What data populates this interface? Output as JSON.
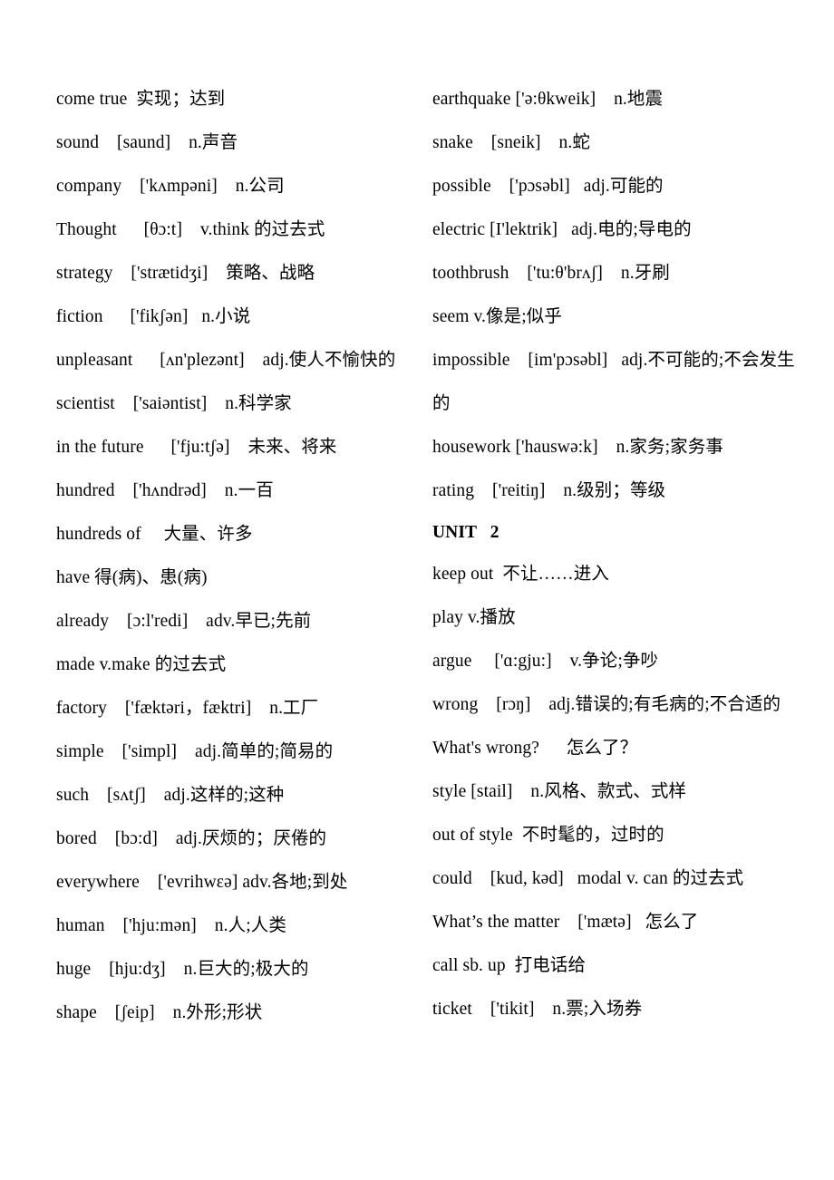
{
  "document": {
    "type": "vocabulary-word-list",
    "language_pair": "English-Chinese",
    "background_color": "#ffffff",
    "text_color": "#000000"
  },
  "left_column": {
    "entries": [
      {
        "id": "come-true",
        "text": "come true  实现；达到"
      },
      {
        "id": "sound",
        "text": "sound    [saund]    n.声音"
      },
      {
        "id": "company",
        "text": "company    ['kʌmpəni]    n.公司"
      },
      {
        "id": "thought",
        "text": "Thought      [θɔ:t]    v.think 的过去式"
      },
      {
        "id": "strategy",
        "text": "strategy    ['strætidʒi]    策略、战略"
      },
      {
        "id": "fiction",
        "text": "fiction      ['fikʃən]   n.小说"
      },
      {
        "id": "unpleasant",
        "text": "unpleasant      [ʌn'plezənt]    adj.使人不愉快的"
      },
      {
        "id": "scientist",
        "text": "scientist    ['saiəntist]    n.科学家"
      },
      {
        "id": "in-the-future",
        "text": "in the future      ['fju:tʃə]    未来、将来"
      },
      {
        "id": "hundred",
        "text": "hundred    ['hʌndrəd]    n.一百"
      },
      {
        "id": "hundreds-of",
        "text": "hundreds of     大量、许多"
      },
      {
        "id": "have",
        "text": "have 得(病)、患(病)"
      },
      {
        "id": "already",
        "text": "already    [ɔ:l'redi]    adv.早已;先前"
      },
      {
        "id": "made",
        "text": "made v.make 的过去式"
      },
      {
        "id": "factory",
        "text": "factory    ['fæktəri，fæktri]    n.工厂"
      },
      {
        "id": "simple",
        "text": "simple    ['simpl]    adj.简单的;简易的"
      },
      {
        "id": "such",
        "text": "such    [sʌtʃ]    adj.这样的;这种"
      },
      {
        "id": "bored",
        "text": "bored    [bɔ:d]    adj.厌烦的；厌倦的"
      },
      {
        "id": "everywhere",
        "text": "everywhere    ['evrihwɛə] adv.各地;到处"
      },
      {
        "id": "human",
        "text": "human    ['hju:mən]    n.人;人类"
      },
      {
        "id": "huge",
        "text": "huge    [hju:dʒ]    n.巨大的;极大的"
      },
      {
        "id": "shape",
        "text": "shape    [ʃeip]    n.外形;形状"
      }
    ]
  },
  "right_column": {
    "entries": [
      {
        "id": "earthquake",
        "text": "earthquake ['ə:θkweik]    n.地震",
        "bold": false
      },
      {
        "id": "snake",
        "text": "snake    [sneik]    n.蛇",
        "bold": false
      },
      {
        "id": "possible",
        "text": "possible    ['pɔsəbl]   adj.可能的",
        "bold": false
      },
      {
        "id": "electric",
        "text": "electric [I'lektrik]   adj.电的;导电的",
        "bold": false
      },
      {
        "id": "toothbrush",
        "text": "toothbrush    ['tu:θ'brʌʃ]    n.牙刷",
        "bold": false
      },
      {
        "id": "seem",
        "text": "seem v.像是;似乎",
        "bold": false
      },
      {
        "id": "impossible",
        "text": "impossible    [im'pɔsəbl]   adj.不可能的;不会发生的",
        "bold": false
      },
      {
        "id": "housework",
        "text": "housework ['hauswə:k]    n.家务;家务事",
        "bold": false
      },
      {
        "id": "rating",
        "text": "rating    ['reitiŋ]    n.级别；等级",
        "bold": false
      },
      {
        "id": "unit-2",
        "text": "UNIT   2",
        "bold": true
      },
      {
        "id": "keep-out",
        "text": "keep out  不让……进入",
        "bold": false
      },
      {
        "id": "play",
        "text": "play v.播放",
        "bold": false
      },
      {
        "id": "argue",
        "text": "argue     ['ɑ:gju:]    v.争论;争吵",
        "bold": false
      },
      {
        "id": "wrong",
        "text": "wrong    [rɔŋ]    adj.错误的;有毛病的;不合适的",
        "bold": false
      },
      {
        "id": "whats-wrong",
        "text": "What's wrong?      怎么了？",
        "bold": false
      },
      {
        "id": "style",
        "text": "style [stail]    n.风格、款式、式样",
        "bold": false
      },
      {
        "id": "out-of-style",
        "text": "out of style  不时髦的，过时的",
        "bold": false
      },
      {
        "id": "could",
        "text": "could    [kud, kəd]   modal v. can 的过去式",
        "bold": false
      },
      {
        "id": "whats-the-matter",
        "text": "What’s the matter    ['mætə]   怎么了",
        "bold": false
      },
      {
        "id": "call-sb-up",
        "text": "call sb. up  打电话给",
        "bold": false
      },
      {
        "id": "ticket",
        "text": "ticket    ['tikit]    n.票;入场券",
        "bold": false
      }
    ]
  }
}
